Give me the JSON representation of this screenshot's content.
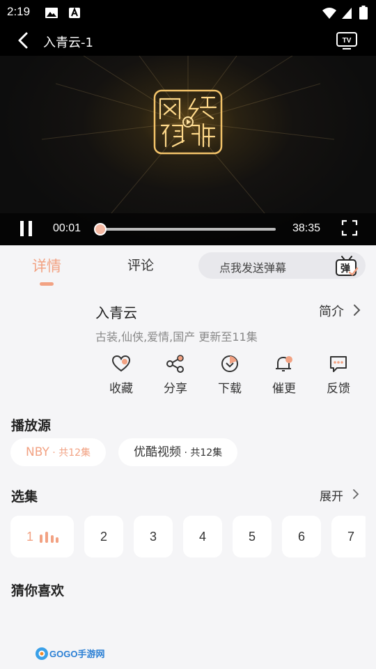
{
  "status": {
    "time": "2:19"
  },
  "header": {
    "title": "入青云-1"
  },
  "player": {
    "current_time": "00:01",
    "total_time": "38:35",
    "progress": 0.0004,
    "logo_text": "网络视听"
  },
  "tabs": {
    "detail": "详情",
    "comments": "评论"
  },
  "danmaku": {
    "placeholder": "点我发送弹幕",
    "icon_text": "弹"
  },
  "show": {
    "title": "入青云",
    "intro_label": "简介",
    "tags": "古装,仙侠,爱情,国产 更新至11集"
  },
  "actions": [
    {
      "label": "收藏",
      "icon": "heart-icon"
    },
    {
      "label": "分享",
      "icon": "share-icon"
    },
    {
      "label": "下载",
      "icon": "download-icon"
    },
    {
      "label": "催更",
      "icon": "bell-icon"
    },
    {
      "label": "反馈",
      "icon": "feedback-icon"
    }
  ],
  "sources": {
    "title": "播放源",
    "items": [
      {
        "name": "NBY",
        "count": " · 共12集"
      },
      {
        "name": "优酷视频",
        "count": " · 共12集"
      }
    ]
  },
  "episodes": {
    "title": "选集",
    "expand_label": "展开",
    "items": [
      "1",
      "2",
      "3",
      "4",
      "5",
      "6",
      "7"
    ]
  },
  "recommend": {
    "title": "猜你喜欢"
  },
  "watermark": {
    "text": "GOGO手游网"
  },
  "colors": {
    "accent": "#f2a283",
    "background": "#f5f5f7"
  }
}
